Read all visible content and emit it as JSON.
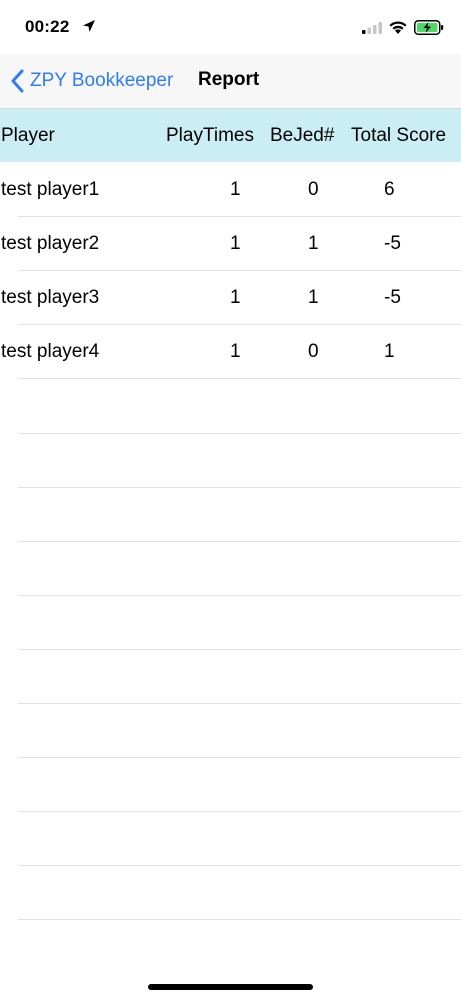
{
  "status_bar": {
    "time": "00:22"
  },
  "nav": {
    "back_label": "ZPY Bookkeeper",
    "title": "Report",
    "accent": "#2f7cf6"
  },
  "table": {
    "headers": {
      "player": "Player",
      "playtimes": "PlayTimes",
      "bejed": "BeJed#",
      "total": "Total Score"
    },
    "header_bg": "#cbeef5",
    "rows": [
      {
        "player": "test player1",
        "playtimes": "1",
        "bejed": "0",
        "total": "6"
      },
      {
        "player": "test player2",
        "playtimes": "1",
        "bejed": "1",
        "total": "-5"
      },
      {
        "player": "test player3",
        "playtimes": "1",
        "bejed": "1",
        "total": "-5"
      },
      {
        "player": "test player4",
        "playtimes": "1",
        "bejed": "0",
        "total": "1"
      }
    ]
  }
}
